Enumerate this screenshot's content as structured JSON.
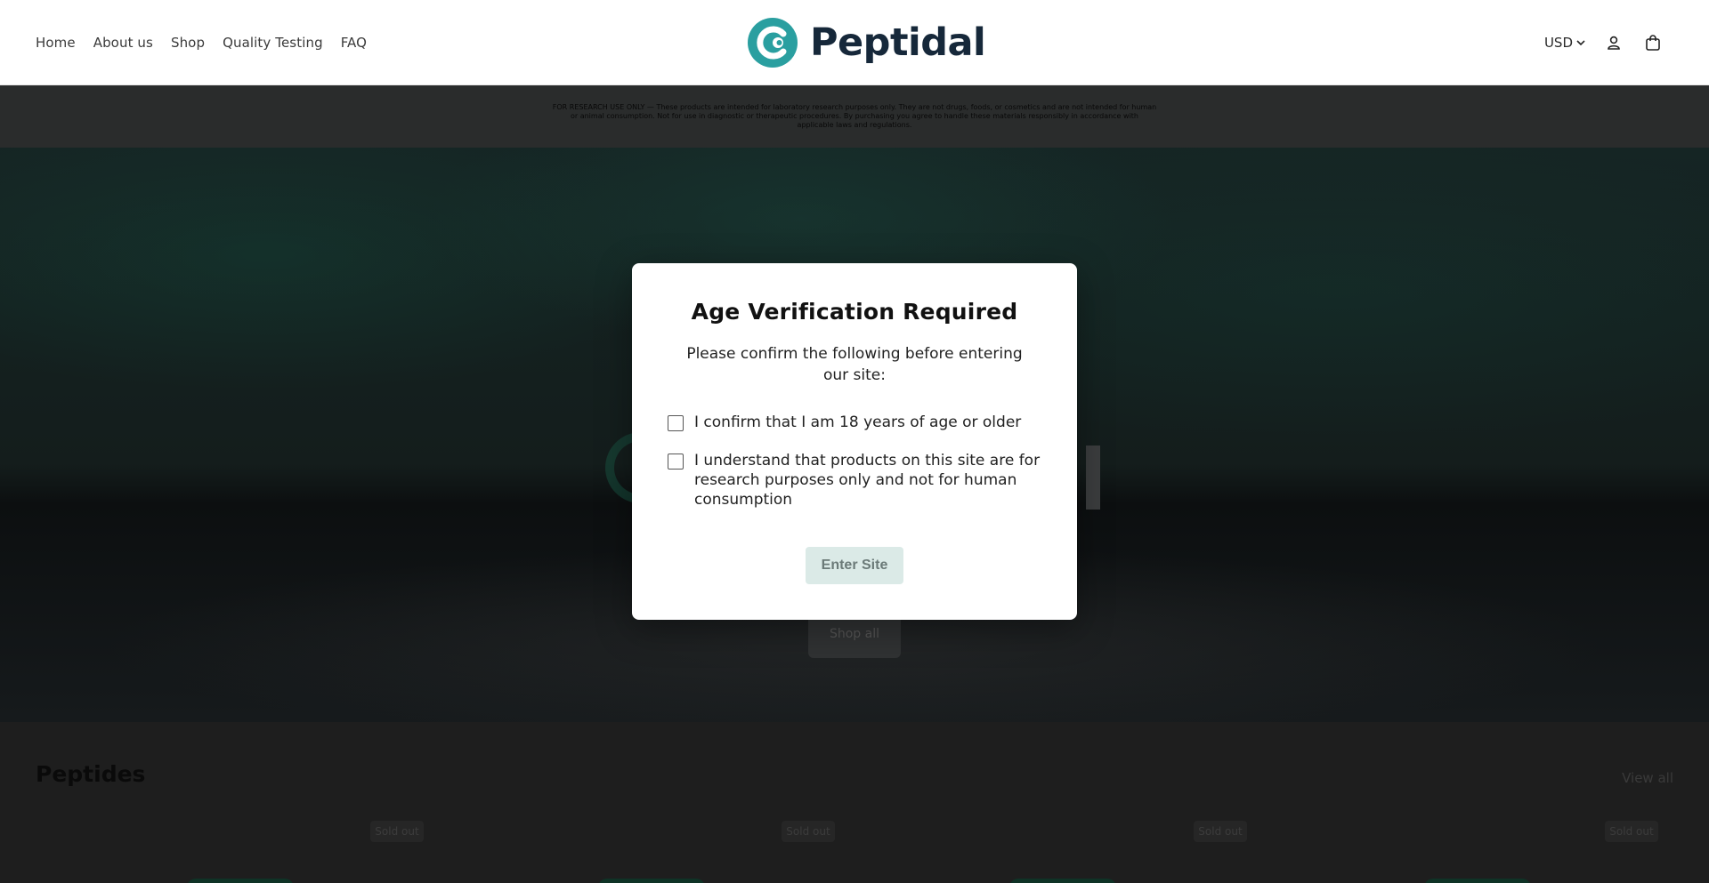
{
  "header": {
    "nav": [
      "Home",
      "About us",
      "Shop",
      "Quality Testing",
      "FAQ"
    ],
    "logo_text": "Peptidal",
    "currency": "USD",
    "icons": [
      "account-icon",
      "cart-icon"
    ]
  },
  "disclaimer": {
    "text": "FOR RESEARCH USE ONLY — These products are intended for laboratory research purposes only. They are not drugs, foods, or cosmetics and are not intended for human or animal consumption. Not for use in diagnostic or therapeutic procedures. By purchasing you agree to handle these materials responsibly in accordance with applicable laws and regulations."
  },
  "hero": {
    "button_label": "Shop all"
  },
  "peptides": {
    "title": "Peptides",
    "view_all": "View all",
    "badges": [
      "Sold out",
      "Sold out",
      "Sold out",
      "Sold out"
    ]
  },
  "modal": {
    "title": "Age Verification Required",
    "subtitle": "Please confirm the following before entering our site:",
    "checks": [
      "I confirm that I am 18 years of age or older",
      "I understand that products on this site are for research purposes only and not for human consumption"
    ],
    "button": "Enter Site"
  },
  "colors": {
    "brand": "#16283a",
    "logo_accent": "#2a9fa0",
    "button_disabled_bg": "#dbeae7"
  }
}
